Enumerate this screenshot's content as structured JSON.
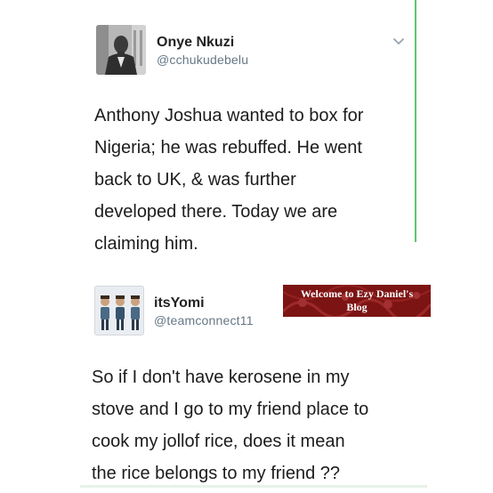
{
  "tweets": [
    {
      "name": "Onye Nkuzi",
      "handle": "@cchukudebelu",
      "body": "Anthony Joshua wanted to box for\nNigeria; he was rebuffed. He went\nback to UK, & was further\ndeveloped there. Today we are\nclaiming him.",
      "avatar_icon": "profile-photo-man-in-suit",
      "menu_icon": "chevron-down-icon"
    },
    {
      "name": "itsYomi",
      "handle": "@teamconnect11",
      "body": "So if I don't have kerosene in my\nstove and I go to my friend place to\ncook my jollof rice, does it mean\nthe rice belongs to my friend ??",
      "avatar_icon": "three-men-avatar"
    }
  ],
  "watermark": {
    "line1": "Welcome to Ezy Daniel's",
    "line2": "Blog"
  },
  "colors": {
    "handle": "#657786",
    "accent_green": "#5cc76b",
    "banner_red": "#7d1414"
  }
}
